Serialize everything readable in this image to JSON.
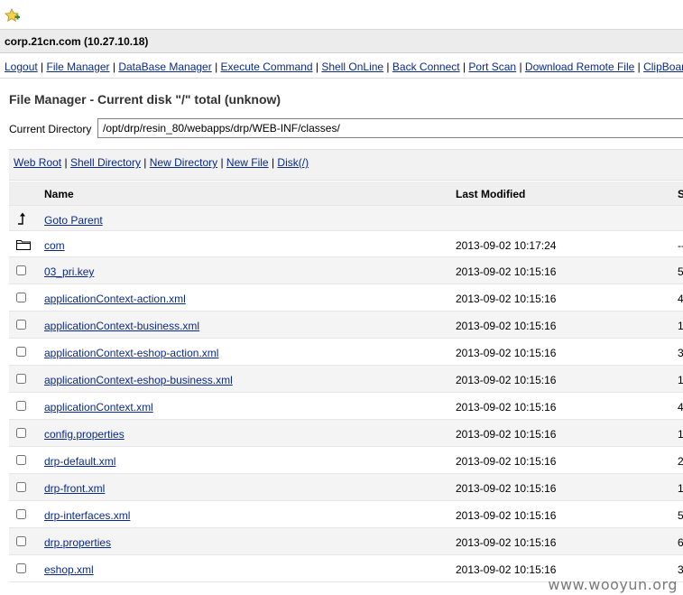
{
  "host": {
    "title": "corp.21cn.com (10.27.10.18)"
  },
  "nav": [
    "Logout",
    "File Manager",
    "DataBase Manager",
    "Execute Command",
    "Shell OnLine",
    "Back Connect",
    "Port Scan",
    "Download Remote File",
    "ClipBoard"
  ],
  "file_manager": {
    "title": "File Manager - Current disk \"/\" total (unknow)",
    "current_dir_label": "Current Directory",
    "current_dir_value": "/opt/drp/resin_80/webapps/drp/WEB-INF/classes/"
  },
  "shortcuts": [
    "Web Root",
    "Shell Directory",
    "New Directory",
    "New File",
    "Disk(/)"
  ],
  "table": {
    "headers": {
      "name": "Name",
      "modified": "Last Modified",
      "size": "S"
    },
    "parent_label": "Goto Parent",
    "rows": [
      {
        "type": "dir",
        "name": "com",
        "modified": "2013-09-02 10:17:24",
        "size": "--"
      },
      {
        "type": "file",
        "name": "03_pri.key",
        "modified": "2013-09-02 10:15:16",
        "size": "5"
      },
      {
        "type": "file",
        "name": "applicationContext-action.xml",
        "modified": "2013-09-02 10:15:16",
        "size": "4"
      },
      {
        "type": "file",
        "name": "applicationContext-business.xml",
        "modified": "2013-09-02 10:15:16",
        "size": "1"
      },
      {
        "type": "file",
        "name": "applicationContext-eshop-action.xml",
        "modified": "2013-09-02 10:15:16",
        "size": "3"
      },
      {
        "type": "file",
        "name": "applicationContext-eshop-business.xml",
        "modified": "2013-09-02 10:15:16",
        "size": "1"
      },
      {
        "type": "file",
        "name": "applicationContext.xml",
        "modified": "2013-09-02 10:15:16",
        "size": "4"
      },
      {
        "type": "file",
        "name": "config.properties",
        "modified": "2013-09-02 10:15:16",
        "size": "1"
      },
      {
        "type": "file",
        "name": "drp-default.xml",
        "modified": "2013-09-02 10:15:16",
        "size": "2"
      },
      {
        "type": "file",
        "name": "drp-front.xml",
        "modified": "2013-09-02 10:15:16",
        "size": "1"
      },
      {
        "type": "file",
        "name": "drp-interfaces.xml",
        "modified": "2013-09-02 10:15:16",
        "size": "5"
      },
      {
        "type": "file",
        "name": "drp.properties",
        "modified": "2013-09-02 10:15:16",
        "size": "6"
      },
      {
        "type": "file",
        "name": "eshop.xml",
        "modified": "2013-09-02 10:15:16",
        "size": "3"
      }
    ]
  },
  "watermark": "www.wooyun.org",
  "colors": {
    "link": "#0a2a8a",
    "host_bar": "#ececec",
    "row_alt": "#f4f4f4"
  }
}
